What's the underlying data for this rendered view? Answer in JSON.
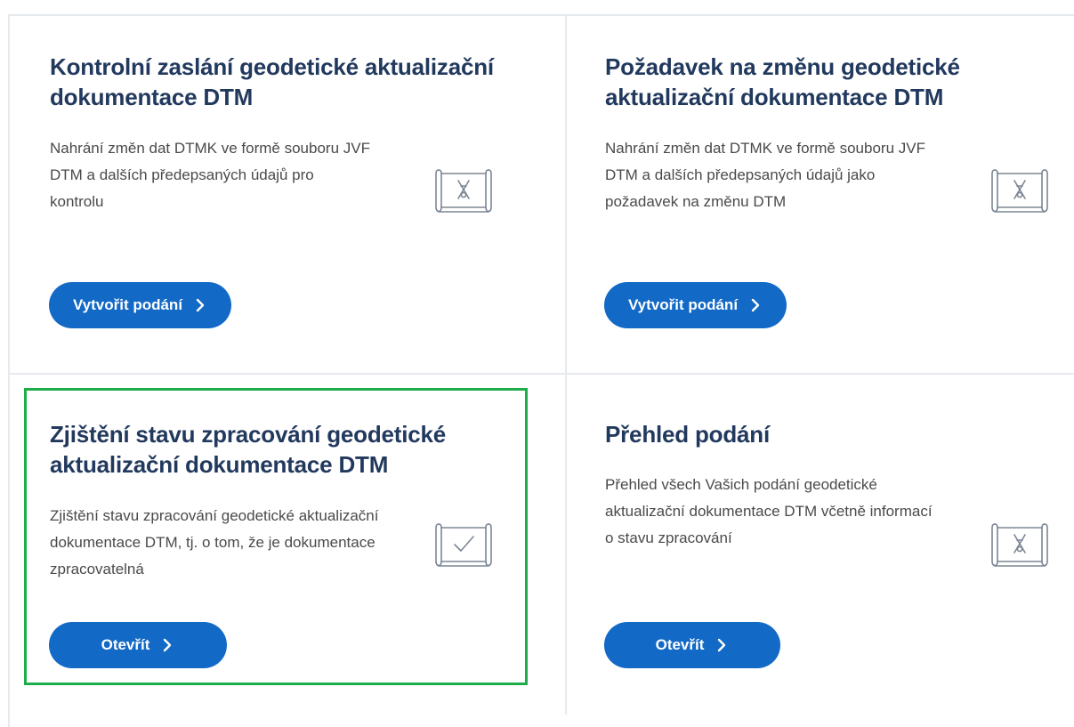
{
  "cards": [
    {
      "title": "Kontrolní zaslání geodetické aktualizační dokumentace DTM",
      "description": "Nahrání změn dat DTMK ve formě souboru JVF DTM a dalších předepsaných údajů pro kontrolu",
      "icon": "map-scroll-icon",
      "button_label": "Vytvořit podání"
    },
    {
      "title": "Požadavek na změnu geodetické aktualizační dokumentace DTM",
      "description": "Nahrání změn dat DTMK ve formě souboru JVF DTM a dalších předepsaných údajů jako požadavek na změnu DTM",
      "icon": "map-scroll-icon",
      "button_label": "Vytvořit podání"
    },
    {
      "title": "Zjištění stavu zpracování geodetické aktualizační dokumentace DTM",
      "description": "Zjištění stavu zpracování geodetické aktualizační dokumentace DTM, tj. o tom, že je dokumentace zpracovatelná",
      "icon": "map-check-icon",
      "button_label": "Otevřít",
      "highlighted": true
    },
    {
      "title": "Přehled podání",
      "description": "Přehled všech Vašich podání geodetické aktualizační dokumentace DTM včetně informací o stavu zpracování",
      "icon": "map-scroll-icon",
      "button_label": "Otevřít"
    }
  ],
  "colors": {
    "title": "#22395e",
    "button": "#1369c6",
    "highlight_border": "#1fad4c",
    "divider": "#e6e9ee"
  }
}
